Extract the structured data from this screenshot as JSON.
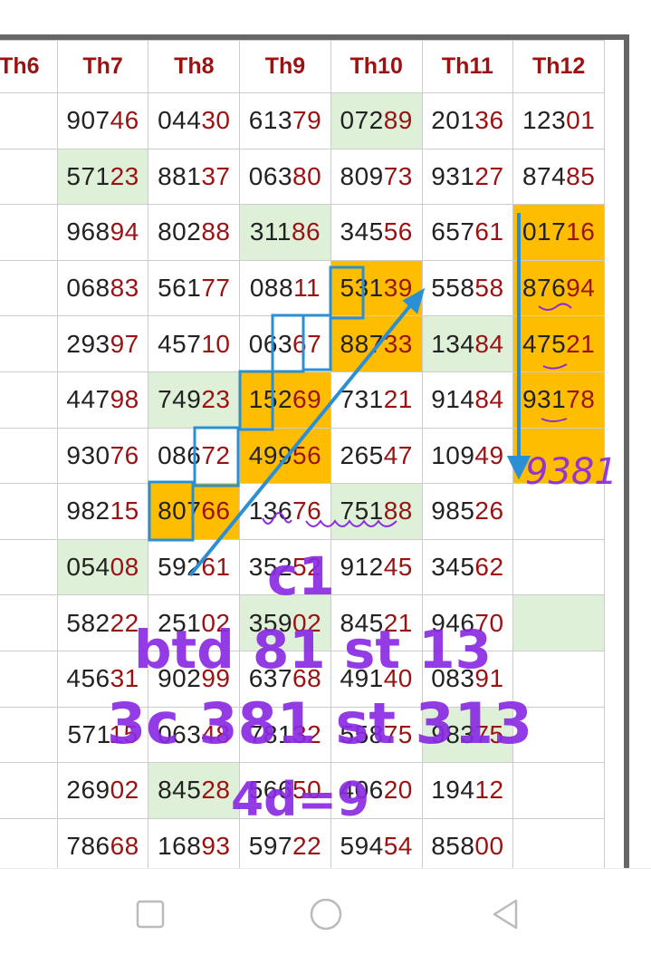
{
  "table": {
    "headers": [
      "Th6",
      "Th7",
      "Th8",
      "Th9",
      "Th10",
      "Th11",
      "Th12"
    ],
    "rows": [
      [
        "90746",
        "04430",
        "61379",
        "07289",
        "20136",
        "12301"
      ],
      [
        "57123",
        "88137",
        "06380",
        "80973",
        "93127",
        "87485"
      ],
      [
        "96894",
        "80288",
        "31186",
        "34556",
        "65761",
        "01716"
      ],
      [
        "06883",
        "56177",
        "08811",
        "53139",
        "55858",
        "87694"
      ],
      [
        "29397",
        "45710",
        "06367",
        "88733",
        "13484",
        "47521"
      ],
      [
        "44798",
        "74923",
        "15269",
        "73121",
        "91484",
        "93178"
      ],
      [
        "93076",
        "08672",
        "49956",
        "26547",
        "10949",
        ""
      ],
      [
        "98215",
        "80766",
        "13676",
        "75188",
        "98526",
        ""
      ],
      [
        "05408",
        "59261",
        "35252",
        "91245",
        "34562",
        ""
      ],
      [
        "58222",
        "25102",
        "35902",
        "84521",
        "94670",
        ""
      ],
      [
        "45631",
        "90299",
        "63768",
        "49140",
        "08391",
        ""
      ],
      [
        "57115",
        "06348",
        "78132",
        "55875",
        "98375",
        ""
      ],
      [
        "26902",
        "84528",
        "56650",
        "40620",
        "19412",
        ""
      ],
      [
        "78668",
        "16893",
        "59722",
        "59454",
        "85800",
        ""
      ]
    ],
    "row_prefixes": [
      "",
      "",
      "",
      "",
      "",
      "",
      "",
      "",
      "",
      "",
      "",
      "",
      "",
      ""
    ]
  },
  "highlights": {
    "green": [
      [
        0,
        3
      ],
      [
        1,
        0
      ],
      [
        2,
        2
      ],
      [
        4,
        4
      ],
      [
        5,
        1
      ],
      [
        7,
        3
      ],
      [
        8,
        0
      ],
      [
        9,
        2
      ],
      [
        9,
        5
      ],
      [
        11,
        4
      ],
      [
        12,
        1
      ]
    ],
    "orange": [
      [
        2,
        5
      ],
      [
        3,
        3
      ],
      [
        3,
        5
      ],
      [
        4,
        3
      ],
      [
        4,
        5
      ],
      [
        5,
        2
      ],
      [
        5,
        5
      ],
      [
        6,
        2
      ],
      [
        6,
        5
      ],
      [
        7,
        1
      ]
    ],
    "colors": {
      "green": "#dff0d8",
      "orange": "#ffbd00",
      "header": "#9b1212",
      "tail": "#9b1212"
    }
  },
  "annotations": {
    "handwritten_number": "9381",
    "line1": "c1",
    "line2": "btd 81 st 13",
    "line3": "3c 381 st 313",
    "line4": "4d=9",
    "colors": {
      "purple": "#8a2be2",
      "blue": "#2b8fd6"
    }
  },
  "navbar": {
    "icons": [
      "recent-apps-icon",
      "home-icon",
      "back-icon"
    ]
  }
}
